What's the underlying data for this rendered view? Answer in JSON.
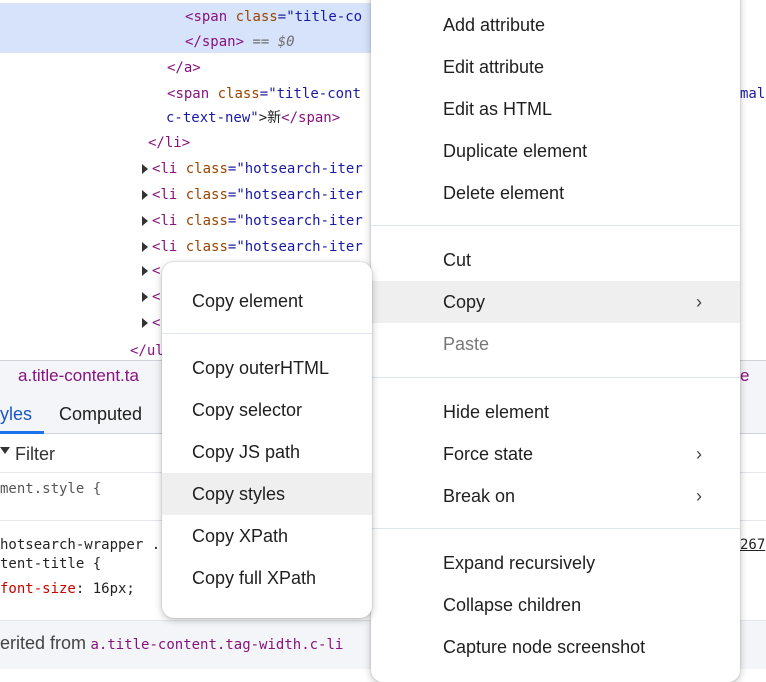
{
  "dom_tree": {
    "lines": [
      {
        "prefix": "<",
        "tag": "span",
        "attr": "class",
        "val": "\"title-co",
        "suffix": ""
      },
      {
        "close": "</span>",
        "comment": " == $0"
      },
      {
        "close": "</a>"
      },
      {
        "prefix": "<",
        "tag": "span",
        "attr": "class",
        "val": "\"title-cont",
        "right_text": "mall"
      },
      {
        "val": "c-text-new\"",
        "text": ">新",
        "close": "</span>"
      },
      {
        "close": "</li>"
      },
      {
        "prefix": "<",
        "tag": "li",
        "attr": "class",
        "val": "\"hotsearch-iter"
      },
      {
        "prefix": "<",
        "tag": "li",
        "attr": "class",
        "val": "\"hotsearch-iter"
      },
      {
        "prefix": "<",
        "tag": "li",
        "attr": "class",
        "val": "\"hotsearch-iter"
      },
      {
        "prefix": "<",
        "tag": "li",
        "attr": "class",
        "val": "\"hotsearch-iter"
      },
      {
        "prefix": "<"
      },
      {
        "prefix": "<"
      },
      {
        "prefix": "<"
      },
      {
        "close": "</ul"
      }
    ]
  },
  "breadcrumb": {
    "text": "a.title-content.ta",
    "right_text": "e"
  },
  "tabs": {
    "styles": "yles",
    "computed": "Computed"
  },
  "filter": {
    "label": "Filter"
  },
  "styles_pane": {
    "element_style": "ment.style {",
    "rule_selector": "hotsearch-wrapper .",
    "rule_selector2": "tent-title {",
    "prop": "font-size",
    "prop_val": "16px;",
    "source_link": "267",
    "inherited_prefix": "erited from",
    "inherited_from": "a.title-content.tag-width.c-li"
  },
  "main_menu": {
    "items": [
      {
        "label": "Add attribute"
      },
      {
        "label": "Edit attribute"
      },
      {
        "label": "Edit as HTML"
      },
      {
        "label": "Duplicate element"
      },
      {
        "label": "Delete element"
      },
      {
        "label": "Cut"
      },
      {
        "label": "Copy"
      },
      {
        "label": "Paste"
      },
      {
        "label": "Hide element"
      },
      {
        "label": "Force state"
      },
      {
        "label": "Break on"
      },
      {
        "label": "Expand recursively"
      },
      {
        "label": "Collapse children"
      },
      {
        "label": "Capture node screenshot"
      }
    ]
  },
  "copy_submenu": {
    "items": [
      {
        "label": "Copy element"
      },
      {
        "label": "Copy outerHTML"
      },
      {
        "label": "Copy selector"
      },
      {
        "label": "Copy JS path"
      },
      {
        "label": "Copy styles"
      },
      {
        "label": "Copy XPath"
      },
      {
        "label": "Copy full XPath"
      }
    ]
  },
  "colors": {
    "selection": "#d7e3fb",
    "tab_accent": "#1a73e8",
    "hover": "#efefef"
  }
}
